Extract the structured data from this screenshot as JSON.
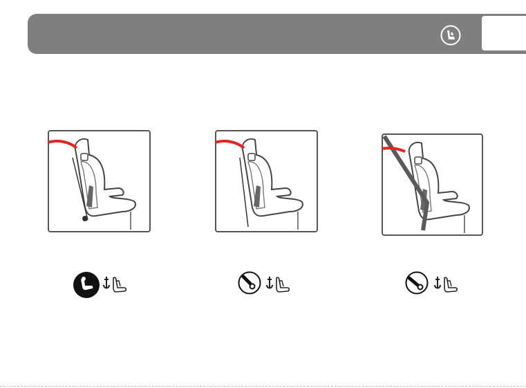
{
  "header": {
    "background": "#807f80",
    "icon": "car-seat-side-icon"
  },
  "figures": [
    {
      "id": "a",
      "icon_left": "isofix-child-seat-icon",
      "icon_left_style": "filled",
      "icon_right": "isofix-anchor-seat-icon",
      "belt": "top-tether"
    },
    {
      "id": "b",
      "icon_left": "belt-buckle-icon",
      "icon_left_style": "outline",
      "icon_right": "isofix-anchor-seat-icon",
      "belt": "lap-belt"
    },
    {
      "id": "c",
      "icon_left": "belt-through-guide-icon",
      "icon_left_style": "outline",
      "icon_right": "isofix-anchor-seat-icon",
      "belt": "diagonal-belt"
    }
  ],
  "colors": {
    "accent_red": "#e52421",
    "belt_gray": "#5a5a5a",
    "outline": "#444444"
  }
}
